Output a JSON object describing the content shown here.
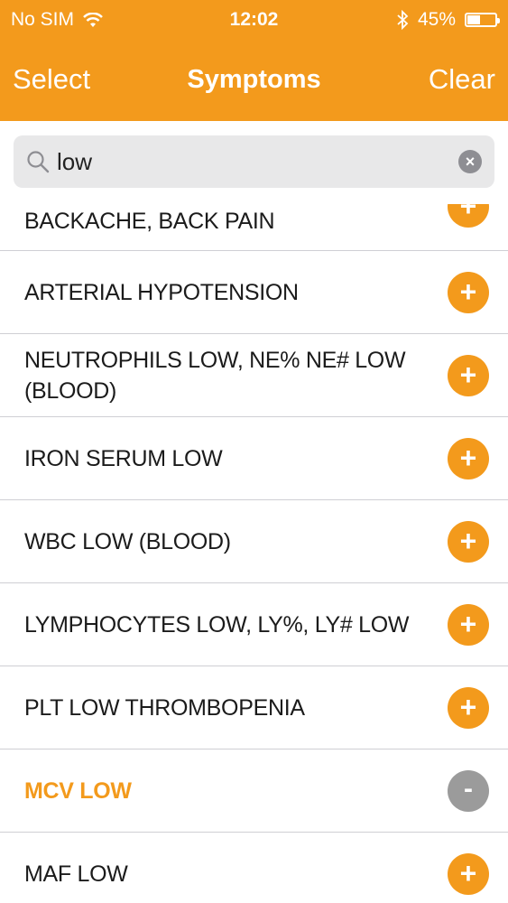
{
  "status_bar": {
    "carrier": "No SIM",
    "time": "12:02",
    "battery": "45%",
    "battery_level": 0.45
  },
  "nav": {
    "left_label": "Select",
    "title": "Symptoms",
    "right_label": "Clear"
  },
  "search": {
    "value": "low",
    "placeholder": ""
  },
  "colors": {
    "accent": "#f39a1c",
    "remove_button": "#9b9b9b",
    "divider": "#cfcfd4"
  },
  "list": {
    "items": [
      {
        "label": "BACKACHE, BACK PAIN",
        "action": "add",
        "selected": false
      },
      {
        "label": "ARTERIAL HYPOTENSION",
        "action": "add",
        "selected": false
      },
      {
        "label": "NEUTROPHILS LOW, NE% NE# LOW (BLOOD)",
        "action": "add",
        "selected": false
      },
      {
        "label": "IRON SERUM LOW",
        "action": "add",
        "selected": false
      },
      {
        "label": "WBC LOW (BLOOD)",
        "action": "add",
        "selected": false
      },
      {
        "label": "LYMPHOCYTES LOW, LY%, LY# LOW",
        "action": "add",
        "selected": false
      },
      {
        "label": "PLT LOW THROMBOPENIA",
        "action": "add",
        "selected": false
      },
      {
        "label": "MCV LOW",
        "action": "remove",
        "selected": true
      },
      {
        "label": "MAF LOW",
        "action": "add",
        "selected": false
      }
    ],
    "add_glyph": "+",
    "remove_glyph": "-"
  }
}
